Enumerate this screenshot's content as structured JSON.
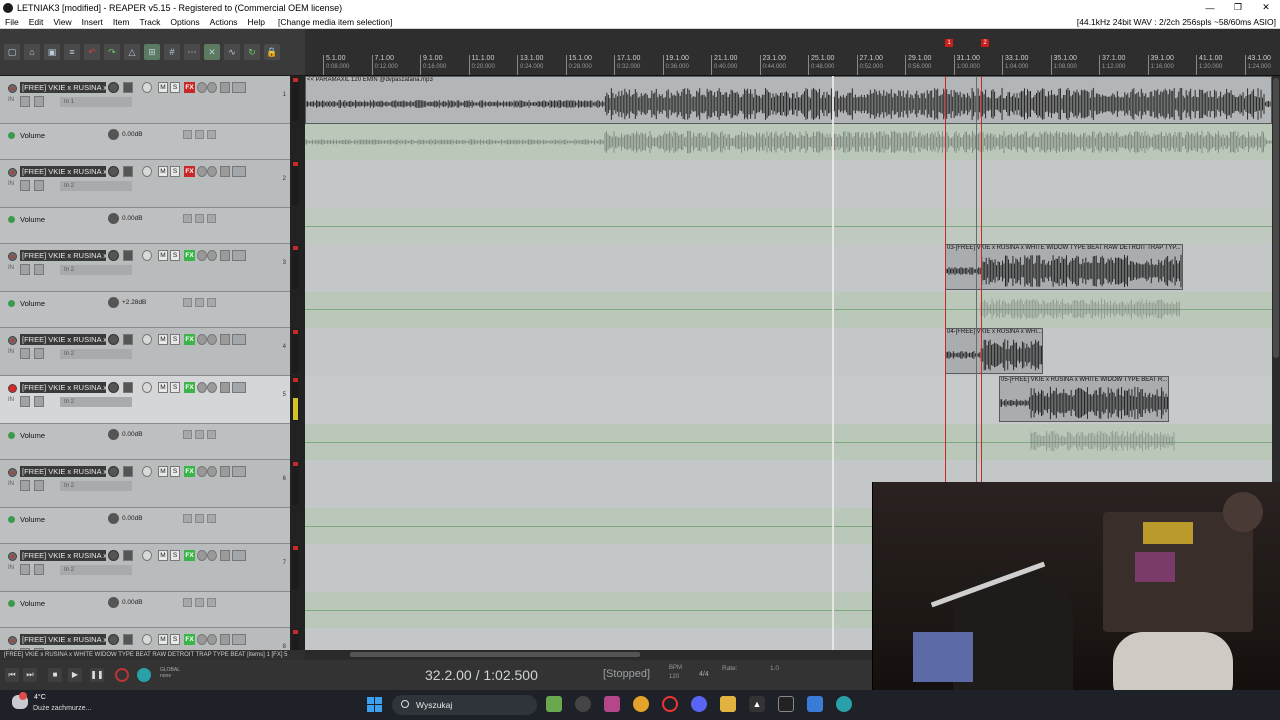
{
  "window": {
    "title": "LETNIAK3 [modified] - REAPER v5.15 - Registered to  (Commercial OEM license)",
    "controls": [
      "—",
      "❐",
      "✕"
    ]
  },
  "menu": {
    "items": [
      "File",
      "Edit",
      "View",
      "Insert",
      "Item",
      "Track",
      "Options",
      "Actions",
      "Help"
    ],
    "context_info": "[Change media item selection]",
    "audio_info": "[44.1kHz 24bit WAV : 2/2ch 256spls ~58/60ms ASIO]"
  },
  "ruler": {
    "markers": [
      "1",
      "2"
    ],
    "ticks": [
      {
        "bar": "5.1.00",
        "time": "0:08.000"
      },
      {
        "bar": "7.1.00",
        "time": "0:12.000"
      },
      {
        "bar": "9.1.00",
        "time": "0:16.000"
      },
      {
        "bar": "11.1.00",
        "time": "0:20.000"
      },
      {
        "bar": "13.1.00",
        "time": "0:24.000"
      },
      {
        "bar": "15.1.00",
        "time": "0:28.000"
      },
      {
        "bar": "17.1.00",
        "time": "0:32.000"
      },
      {
        "bar": "19.1.00",
        "time": "0:36.000"
      },
      {
        "bar": "21.1.00",
        "time": "0:40.000"
      },
      {
        "bar": "23.1.00",
        "time": "0:44.000"
      },
      {
        "bar": "25.1.00",
        "time": "0:48.000"
      },
      {
        "bar": "27.1.00",
        "time": "0:52.000"
      },
      {
        "bar": "29.1.00",
        "time": "0:56.000"
      },
      {
        "bar": "31.1.00",
        "time": "1:00.000"
      },
      {
        "bar": "33.1.00",
        "time": "1:04.000"
      },
      {
        "bar": "35.1.00",
        "time": "1:08.000"
      },
      {
        "bar": "37.1.00",
        "time": "1:12.000"
      },
      {
        "bar": "39.1.00",
        "time": "1:16.000"
      },
      {
        "bar": "41.1.00",
        "time": "1:20.000"
      },
      {
        "bar": "43.1.00",
        "time": "1:24.000"
      }
    ]
  },
  "tracks": [
    {
      "name": "[FREE] VKIE x RUSINA x WHITE WIDOW TYPE BEAT",
      "num": "1",
      "fx": "red",
      "input": "In 1",
      "volume_label": "Volume",
      "volume": "0.00dB",
      "selected": false
    },
    {
      "name": "[FREE] VKIE x RUSINA x WHITE WIDOW TYPE BEAT",
      "num": "2",
      "fx": "red",
      "input": "In 2",
      "volume_label": "Volume",
      "volume": "0.00dB",
      "selected": false
    },
    {
      "name": "[FREE] VKIE x RUSINA x WHITE WIDOW TYPE BEAT",
      "num": "3",
      "fx": "green",
      "input": "In 2",
      "volume_label": "Volume",
      "volume": "+2.28dB",
      "selected": false
    },
    {
      "name": "[FREE] VKIE x RUSINA x WHITE WIDOW TYPE BEAT",
      "num": "4",
      "fx": "green",
      "input": "In 2",
      "volume_label": "",
      "volume": "",
      "selected": false
    },
    {
      "name": "[FREE] VKIE x RUSINA x WHITE WIDOW TYPE BEAT",
      "num": "5",
      "fx": "green",
      "input": "In 2",
      "volume_label": "Volume",
      "volume": "0.00dB",
      "selected": true
    },
    {
      "name": "[FREE] VKIE x RUSINA x WHITE WIDOW TYPE BEAT",
      "num": "6",
      "fx": "green",
      "input": "In 2",
      "volume_label": "Volume",
      "volume": "0.00dB",
      "selected": false
    },
    {
      "name": "[FREE] VKIE x RUSINA x WHITE WIDOW TYPE BEAT",
      "num": "7",
      "fx": "green",
      "input": "In 2",
      "volume_label": "Volume",
      "volume": "0.00dB",
      "selected": false
    },
    {
      "name": "[FREE] VKIE x RUSINA x WHITE WIDOW TYPE BEAT",
      "num": "8",
      "fx": "green",
      "input": "",
      "volume_label": "",
      "volume": "",
      "selected": false
    }
  ],
  "track_buttons": {
    "mute": "M",
    "solo": "S",
    "io_label": "IN"
  },
  "items": {
    "item1": "<< PARAMAXIL 120 EMIN @dvpaszatana.mp3",
    "item3": "03-[FREE] VKIE x RUSINA x WHITE WIDOW TYPE BEAT  RAW  DETROIT TRAP TYP...",
    "item4": "04-[FREE] VKIE x RUSINA x WHI...",
    "item5": "05-[FREE] VKIE x RUSINA x WHITE WIDOW TYPE BEAT  R..."
  },
  "status": {
    "selection": "[FREE] VKIE x RUSINA x WHITE WIDOW TYPE BEAT  RAW  DETROIT TRAP TYPE BEAT [items] 1 [FX] 5"
  },
  "transport": {
    "position": "32.2.00 / 1:02.500",
    "state": "[Stopped]",
    "bpm_label": "BPM",
    "bpm": "120",
    "timesig": "4/4",
    "rate_label": "Rate:",
    "rate": "1.0",
    "global_label": "GLOBAL",
    "global_value": "none"
  },
  "taskbar": {
    "temperature": "4°C",
    "condition": "Duże zachmurze...",
    "search_placeholder": "Wyszukaj"
  }
}
